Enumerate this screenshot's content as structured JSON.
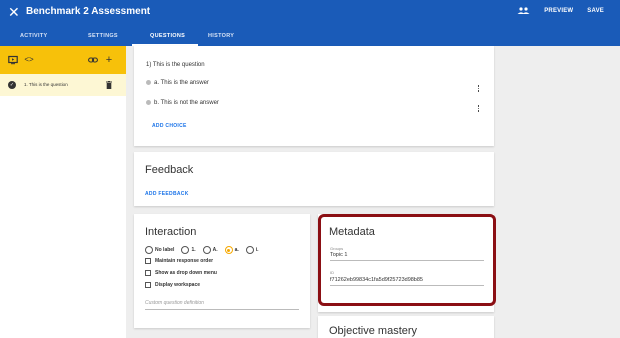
{
  "header": {
    "close_icon": "close-icon",
    "title": "Benchmark 2 Assessment",
    "people_icon": "people-icon",
    "preview_label": "PREVIEW",
    "save_label": "SAVE",
    "color": "#1a5bb8"
  },
  "tabs": [
    {
      "label": "ACTIVITY"
    },
    {
      "label": "SETTINGS"
    },
    {
      "label": "QUESTIONS",
      "active": true
    },
    {
      "label": "HISTORY"
    }
  ],
  "sidebar": {
    "toolbar_color": "#f7c10a",
    "icons": [
      "screen-icon",
      "code-icon",
      "link-icon",
      "plus-icon"
    ],
    "items": [
      {
        "label": "1. This is the question",
        "status_icon": "check-circle-icon",
        "delete_icon": "trash-icon"
      }
    ]
  },
  "question": {
    "prompt": "1)  This is the question",
    "choices": [
      {
        "label": "a.  This is the answer",
        "correct": true
      },
      {
        "label": "b.  This is not the answer",
        "correct": false
      }
    ],
    "add_choice_label": "ADD CHOICE"
  },
  "feedback": {
    "title": "Feedback",
    "add_feedback_label": "ADD FEEDBACK"
  },
  "interaction": {
    "title": "Interaction",
    "label_options": [
      {
        "label": "No label",
        "selected": false
      },
      {
        "label": "1.",
        "selected": false
      },
      {
        "label": "A.",
        "selected": false
      },
      {
        "label": "a.",
        "selected": true
      },
      {
        "label": "i.",
        "selected": false
      }
    ],
    "checkboxes": [
      {
        "label": "Maintain response order",
        "checked": false
      },
      {
        "label": "Show as drop down menu",
        "checked": false
      },
      {
        "label": "Display workspace",
        "checked": false
      }
    ],
    "custom_placeholder": "Custom question definition"
  },
  "metadata": {
    "title": "Metadata",
    "groups_label": "Groups",
    "groups_value": "Topic 1",
    "id_label": "ID",
    "id_value": "f71262eb99834c1fa5d9f25723d98b85",
    "highlight_color": "#8b0f14"
  },
  "objective": {
    "title": "Objective mastery"
  }
}
